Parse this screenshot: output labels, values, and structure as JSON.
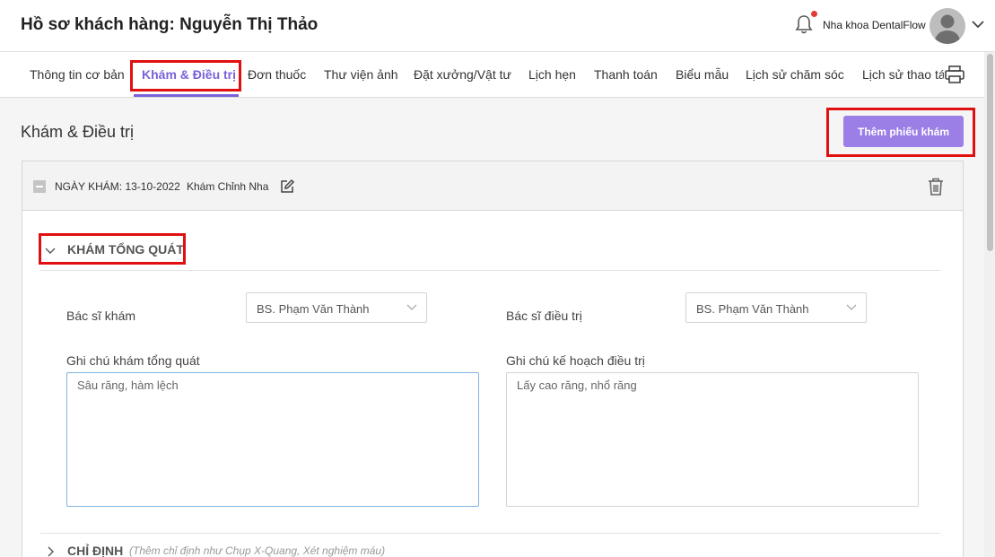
{
  "header": {
    "title": "Hồ sơ khách hàng: Nguyễn Thị Thảo",
    "clinic_name": "Nha khoa DentalFlow",
    "icons": [
      "bell-icon",
      "avatar",
      "chevron-down-icon"
    ]
  },
  "tabs": [
    {
      "label": "Thông tin cơ bản"
    },
    {
      "label": "Khám & Điều trị",
      "active": true
    },
    {
      "label": "Đơn thuốc"
    },
    {
      "label": "Thư viện ảnh"
    },
    {
      "label": "Đặt xưởng/Vật tư"
    },
    {
      "label": "Lịch hẹn"
    },
    {
      "label": "Thanh toán"
    },
    {
      "label": "Biểu mẫu"
    },
    {
      "label": "Lịch sử chăm sóc"
    },
    {
      "label": "Lịch sử thao tác"
    }
  ],
  "main": {
    "section_title": "Khám & Điều trị",
    "add_button": "Thêm phiếu khám"
  },
  "visit": {
    "date": "NGÀY KHÁM: 13-10-2022",
    "type": "Khám Chỉnh Nha"
  },
  "general_exam": {
    "title": "KHÁM TỔNG QUÁT",
    "examining_doctor_label": "Bác sĩ khám",
    "examining_doctor_value": "BS. Phạm Văn Thành",
    "treating_doctor_label": "Bác sĩ điều trị",
    "treating_doctor_value": "BS. Phạm Văn Thành",
    "exam_note_label": "Ghi chú khám tổng quát",
    "exam_note_value": "Sâu răng, hàm lệch",
    "plan_note_label": "Ghi chú kế hoạch điều trị",
    "plan_note_value": "Lấy cao răng, nhổ răng"
  },
  "orders": {
    "title": "CHỈ ĐỊNH",
    "hint": "(Thêm chỉ định như Chụp X-Quang, Xét nghiệm máu)"
  },
  "colors": {
    "accent": "#7b61d9",
    "button": "#9b7ee6",
    "highlight": "#e01010",
    "notification_dot": "#e53935"
  }
}
